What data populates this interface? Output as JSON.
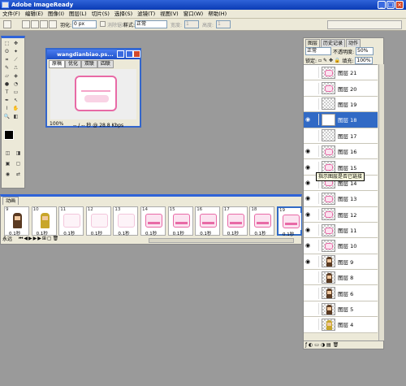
{
  "app": {
    "title": "Adobe ImageReady"
  },
  "menu": [
    "文件(F)",
    "编辑(E)",
    "图像(I)",
    "图层(L)",
    "切片(S)",
    "选择(S)",
    "滤镜(T)",
    "视图(V)",
    "窗口(W)",
    "帮助(H)"
  ],
  "options": {
    "feather_label": "羽化:",
    "feather_value": "0 px",
    "antialias_label": "消除锯齿",
    "style_label": "样式:",
    "style_value": "正常",
    "width_label": "宽度:",
    "width_value": "1",
    "height_label": "高度:",
    "height_value": "1"
  },
  "image_window": {
    "title": "wangdianbiao.ps...",
    "tabs": [
      "原稿",
      "优化",
      "双联",
      "四联"
    ],
    "zoom": "100%",
    "status": "-- / -- 秒 @ 28.8 Kbps"
  },
  "layers_panel": {
    "tabs": [
      "图层",
      "历史记录",
      "动作"
    ],
    "blend_mode": "正常",
    "opacity_label": "不透明度:",
    "opacity_value": "50%",
    "lock_label": "锁定:",
    "fill_label": "填充:",
    "fill_value": "100%",
    "layers": [
      {
        "name": "图层 21",
        "visible": false,
        "thumb": "pink",
        "selected": false
      },
      {
        "name": "图层 20",
        "visible": false,
        "thumb": "pink",
        "selected": false
      },
      {
        "name": "图层 19",
        "visible": false,
        "thumb": "empty",
        "selected": false
      },
      {
        "name": "图层 18",
        "visible": true,
        "thumb": "white",
        "selected": true
      },
      {
        "name": "图层 17",
        "visible": false,
        "thumb": "empty",
        "selected": false
      },
      {
        "name": "图层 16",
        "visible": true,
        "thumb": "pink",
        "selected": false
      },
      {
        "name": "图层 15",
        "visible": true,
        "thumb": "pink",
        "selected": false
      },
      {
        "name": "图层 14",
        "visible": true,
        "thumb": "pink",
        "selected": false
      },
      {
        "name": "图层 13",
        "visible": true,
        "thumb": "pink",
        "selected": false
      },
      {
        "name": "图层 12",
        "visible": true,
        "thumb": "pink",
        "selected": false
      },
      {
        "name": "图层 11",
        "visible": true,
        "thumb": "pink",
        "selected": false
      },
      {
        "name": "图层 10",
        "visible": true,
        "thumb": "pink",
        "selected": false
      },
      {
        "name": "图层 9",
        "visible": true,
        "thumb": "char",
        "selected": false
      },
      {
        "name": "图层 8",
        "visible": false,
        "thumb": "char",
        "selected": false
      },
      {
        "name": "图层 6",
        "visible": false,
        "thumb": "char",
        "selected": false
      },
      {
        "name": "图层 5",
        "visible": false,
        "thumb": "char",
        "selected": false
      },
      {
        "name": "图层 4",
        "visible": false,
        "thumb": "charyel",
        "selected": false
      }
    ]
  },
  "tooltip": "指示图层是否已链接",
  "animation": {
    "tab": "动画",
    "loop": "永远",
    "frames": [
      {
        "num": "9",
        "delay": "0.1秒",
        "kind": "char"
      },
      {
        "num": "10",
        "delay": "0.1秒",
        "kind": "charyel"
      },
      {
        "num": "11",
        "delay": "0.1秒",
        "kind": "pale"
      },
      {
        "num": "12",
        "delay": "0.1秒",
        "kind": "pale"
      },
      {
        "num": "13",
        "delay": "0.1秒",
        "kind": "pale"
      },
      {
        "num": "14",
        "delay": "0.1秒",
        "kind": "pink"
      },
      {
        "num": "15",
        "delay": "0.1秒",
        "kind": "pink"
      },
      {
        "num": "16",
        "delay": "0.1秒",
        "kind": "pink"
      },
      {
        "num": "17",
        "delay": "0.1秒",
        "kind": "pink"
      },
      {
        "num": "18",
        "delay": "0.1秒",
        "kind": "pink"
      },
      {
        "num": "19",
        "delay": "0.1秒",
        "kind": "pink"
      }
    ]
  },
  "colors": {
    "title_blue": "#0a3bb5",
    "selection": "#316ac5",
    "chrome": "#ece9d8",
    "workspace": "#9a9a9a"
  }
}
